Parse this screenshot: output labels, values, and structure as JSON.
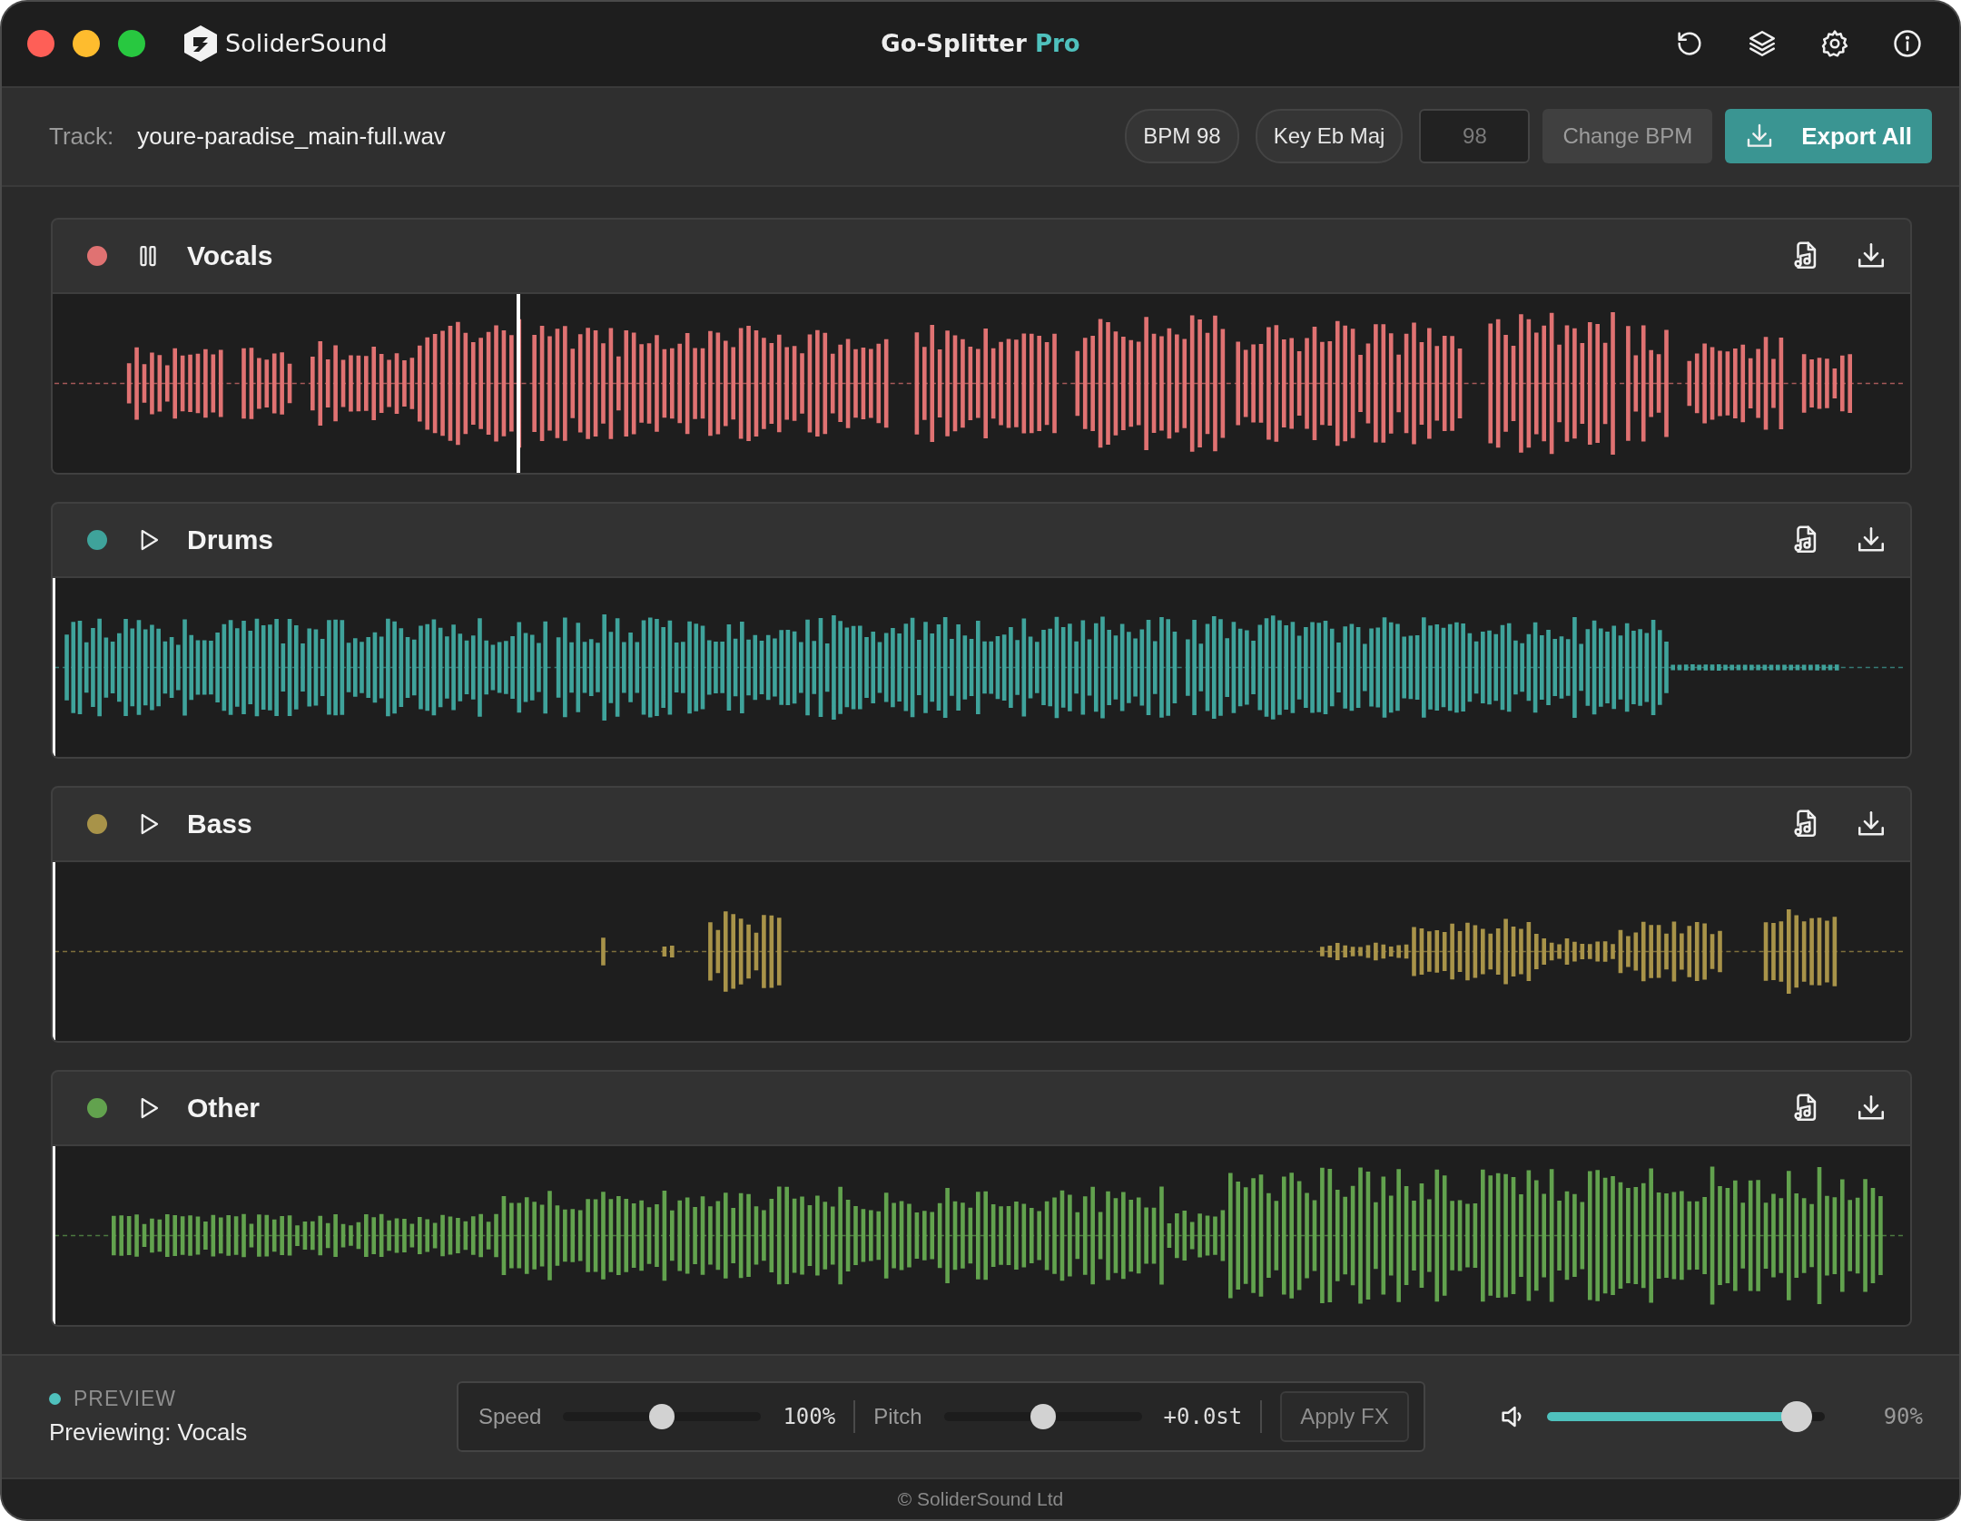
{
  "app": {
    "brand": "SoliderSound",
    "title": "Go-Splitter",
    "edition": "Pro"
  },
  "track": {
    "label": "Track:",
    "filename": "youre-paradise_main-full.wav"
  },
  "tags": [
    "BPM 98",
    "Key Eb Maj"
  ],
  "bpm_input": {
    "placeholder": "98"
  },
  "change_bpm": "Change BPM",
  "export": "Export All",
  "stems": [
    {
      "name": "Vocals",
      "color": "#e07272",
      "playing": true,
      "level": 0.25
    },
    {
      "name": "Drums",
      "color": "#3fa39b",
      "playing": false,
      "level": 0
    },
    {
      "name": "Bass",
      "color": "#a89349",
      "playing": false,
      "level": 0
    },
    {
      "name": "Other",
      "color": "#62a24e",
      "playing": false,
      "level": 0
    }
  ],
  "preview": {
    "label": "PREVIEW",
    "text": "Previewing: Vocals"
  },
  "fx": {
    "controls": [
      {
        "label": "Speed",
        "level": 0.5,
        "reading": "100%"
      },
      {
        "label": "Pitch",
        "level": 0.5,
        "reading": "+0.0st"
      }
    ],
    "apply": "Apply FX"
  },
  "volume": {
    "level": 0.9,
    "reading": "90%"
  },
  "footer": "© SoliderSound Ltd"
}
